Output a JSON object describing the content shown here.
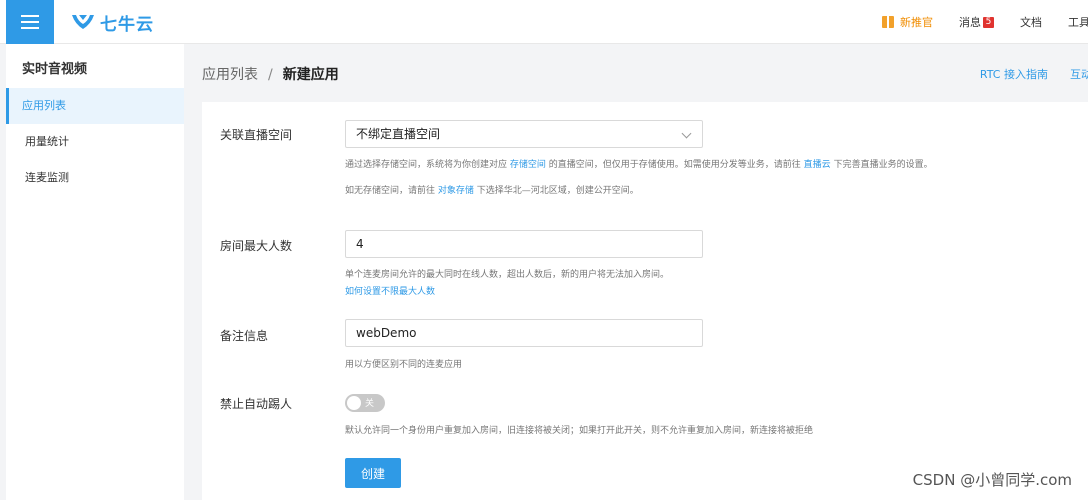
{
  "header": {
    "logo_text": "七牛云",
    "links": {
      "new_feature": "新推官",
      "messages": "消息",
      "messages_count": "5",
      "docs": "文档",
      "tools_cut": "工具"
    }
  },
  "sidebar": {
    "title": "实时音视频",
    "items": [
      {
        "label": "应用列表"
      },
      {
        "label": "用量统计"
      },
      {
        "label": "连麦监测"
      }
    ]
  },
  "breadcrumb": {
    "parent": "应用列表",
    "separator": "/",
    "current": "新建应用"
  },
  "page_links": {
    "rtc_guide": "RTC 接入指南",
    "cut": "互动"
  },
  "form": {
    "live_space": {
      "label": "关联直播空间",
      "value": "不绑定直播空间",
      "hint1_a": "通过选择存储空间，系统将为你创建对应",
      "hint1_link1": "存储空间",
      "hint1_b": "的直播空间，但仅用于存储使用。如需使用分发等业务，请前往",
      "hint1_link2": "直播云",
      "hint1_c": "下完善直播业务的设置。",
      "hint2_a": "如无存储空间，请前往",
      "hint2_link": "对象存储",
      "hint2_b": "下选择华北—河北区域，创建公开空间。"
    },
    "max_users": {
      "label": "房间最大人数",
      "value": "4",
      "hint": "单个连麦房间允许的最大同时在线人数，超出人数后，新的用户将无法加入房间。",
      "link": "如何设置不限最大人数"
    },
    "remark": {
      "label": "备注信息",
      "value": "webDemo",
      "hint": "用以方便区别不同的连麦应用"
    },
    "kick": {
      "label": "禁止自动踢人",
      "toggle_label": "关",
      "toggle_on": false,
      "hint": "默认允许同一个身份用户重复加入房间，旧连接将被关闭；如果打开此开关，则不允许重复加入房间，新连接将被拒绝"
    },
    "submit": "创建"
  },
  "watermark": "CSDN @小曾同学.com"
}
